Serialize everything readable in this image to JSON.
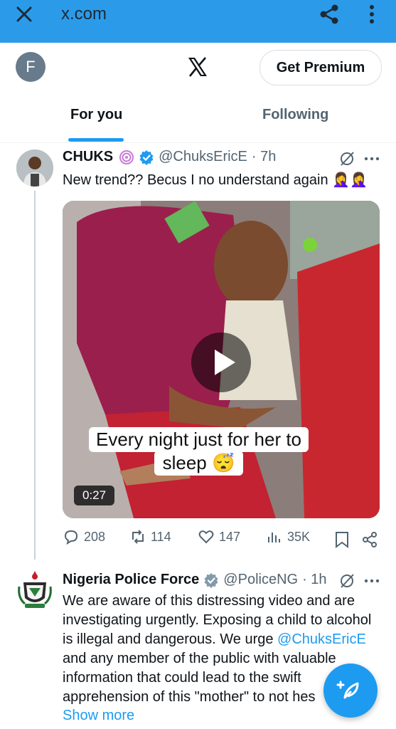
{
  "browser": {
    "url": "x.com"
  },
  "header": {
    "avatar_letter": "F",
    "premium_label": "Get Premium"
  },
  "tabs": {
    "for_you": "For you",
    "following": "Following"
  },
  "tweet1": {
    "name": "CHUKS",
    "handle": "@ChuksEricE",
    "time": "· 7h",
    "text": "New trend?? Becus I no understand again 🤦‍♀️🤦‍♀️",
    "video": {
      "caption_line1": "Every night just for her to",
      "caption_line2": "sleep 😴",
      "duration": "0:27"
    },
    "stats": {
      "replies": "208",
      "reposts": "114",
      "likes": "147",
      "views": "35K"
    }
  },
  "tweet2": {
    "name": "Nigeria Police Force",
    "handle": "@PoliceNG",
    "time": "· 1h",
    "text_part1": "We are aware of this distressing video and are investigating urgently. Exposing a child to alcohol is illegal and dangerous. We urge ",
    "mention": "@ChuksEricE",
    "text_part2": " and any member of the public with valuable information that could lead to the swift apprehension of this \"mother\" to not hes",
    "show_more": "Show more"
  },
  "colors": {
    "accent": "#1d9bf0",
    "browser_bar": "#2b9be9",
    "muted": "#536471"
  }
}
